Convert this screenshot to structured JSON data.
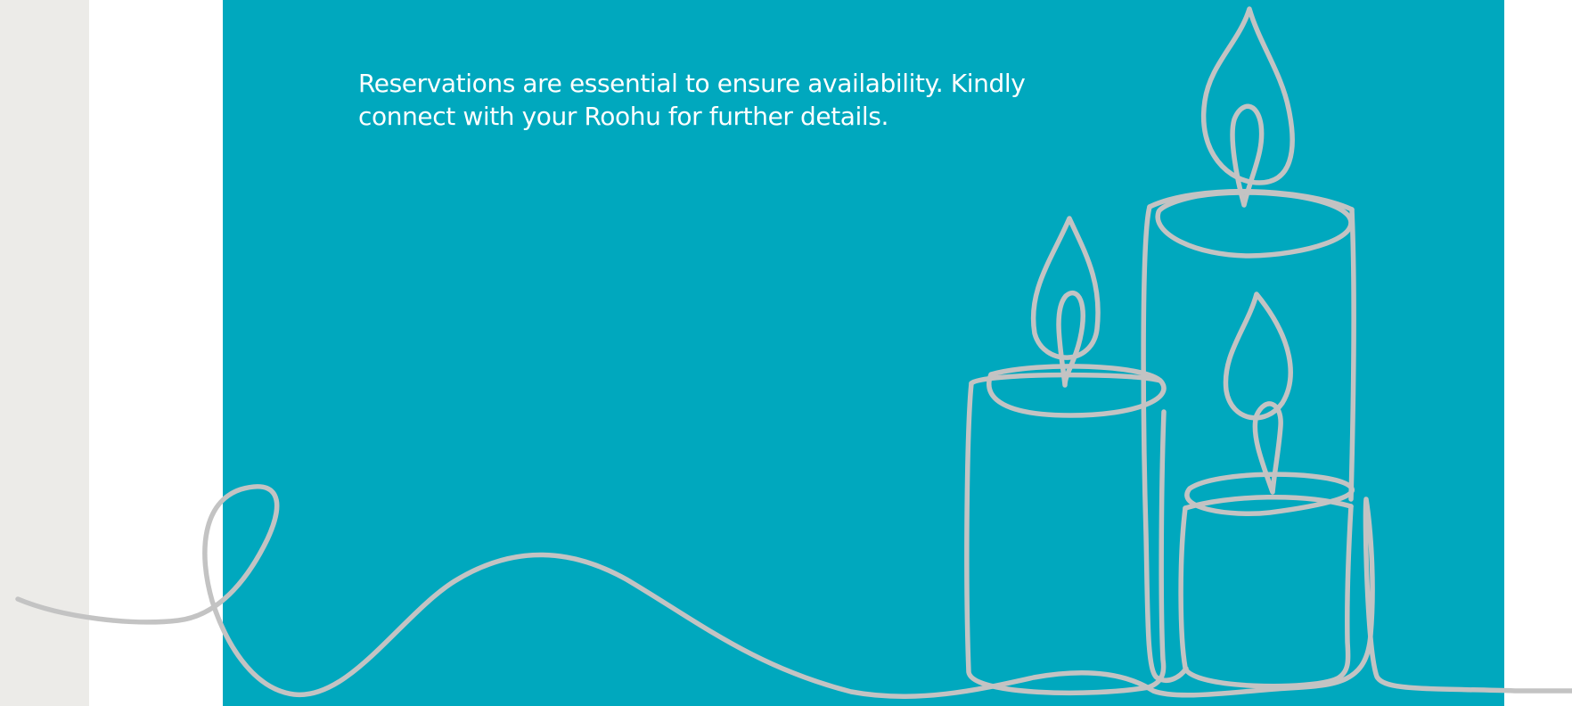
{
  "notice": {
    "text": "Reservations are essential to ensure availability. Kindly connect with your Roohu for further details."
  },
  "theme": {
    "panel_color": "#00a8be",
    "gutter_color": "#ecebe8",
    "line_color": "#c3c3c3",
    "text_color": "#ffffff"
  },
  "illustration": {
    "icon": "candles-line-art-icon"
  }
}
